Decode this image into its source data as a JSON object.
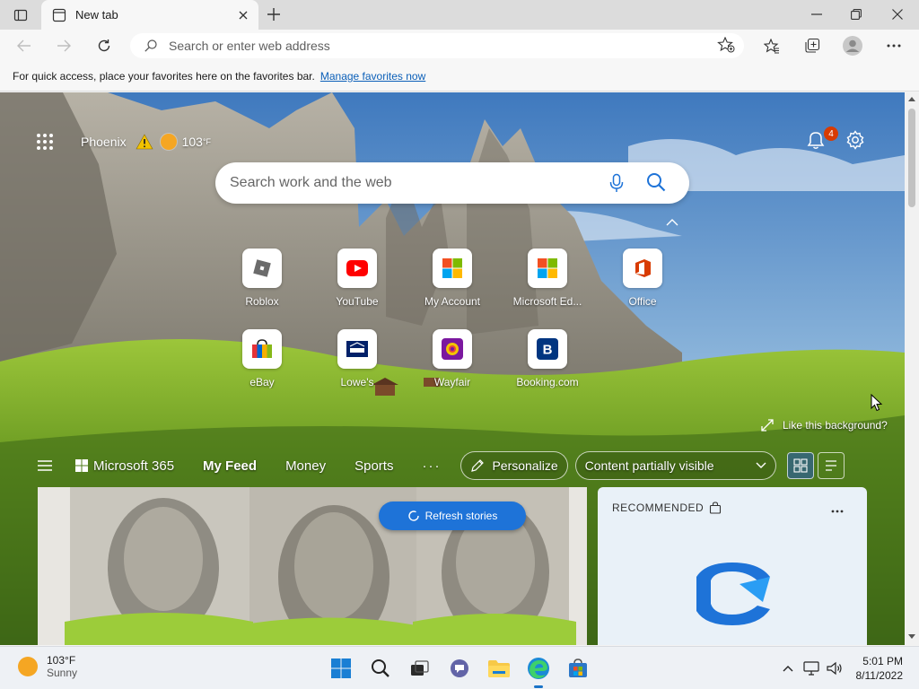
{
  "browser": {
    "tab_title": "New tab",
    "address_placeholder": "Search or enter web address"
  },
  "favorites_bar": {
    "message": "For quick access, place your favorites here on the favorites bar.",
    "link": "Manage favorites now"
  },
  "header": {
    "city": "Phoenix",
    "temperature": "103",
    "unit": "°F",
    "notifications_count": "4"
  },
  "search": {
    "placeholder": "Search work and the web"
  },
  "tiles": [
    {
      "label": "Roblox",
      "icon": "roblox-icon"
    },
    {
      "label": "YouTube",
      "icon": "youtube-icon"
    },
    {
      "label": "My Account",
      "icon": "microsoft-icon"
    },
    {
      "label": "Microsoft Ed...",
      "icon": "microsoft-icon"
    },
    {
      "label": "Office",
      "icon": "office-icon"
    },
    {
      "label": "eBay",
      "icon": "ebay-icon"
    },
    {
      "label": "Lowe's",
      "icon": "lowes-icon"
    },
    {
      "label": "Wayfair",
      "icon": "wayfair-icon"
    },
    {
      "label": "Booking.com",
      "icon": "booking-icon"
    }
  ],
  "background": {
    "like_label": "Like this background?"
  },
  "feed": {
    "ms365_label": "Microsoft 365",
    "tabs": [
      "My Feed",
      "Money",
      "Sports"
    ],
    "more_label": "···",
    "personalize_label": "Personalize",
    "visibility_label": "Content partially visible",
    "refresh_label": "Refresh stories",
    "recommended_label": "RECOMMENDED"
  },
  "taskbar": {
    "weather_temp": "103°F",
    "weather_desc": "Sunny",
    "time": "5:01 PM",
    "date": "8/11/2022"
  },
  "colors": {
    "accent": "#1e73d8",
    "badge": "#d83b01",
    "sun": "#f5a623"
  }
}
